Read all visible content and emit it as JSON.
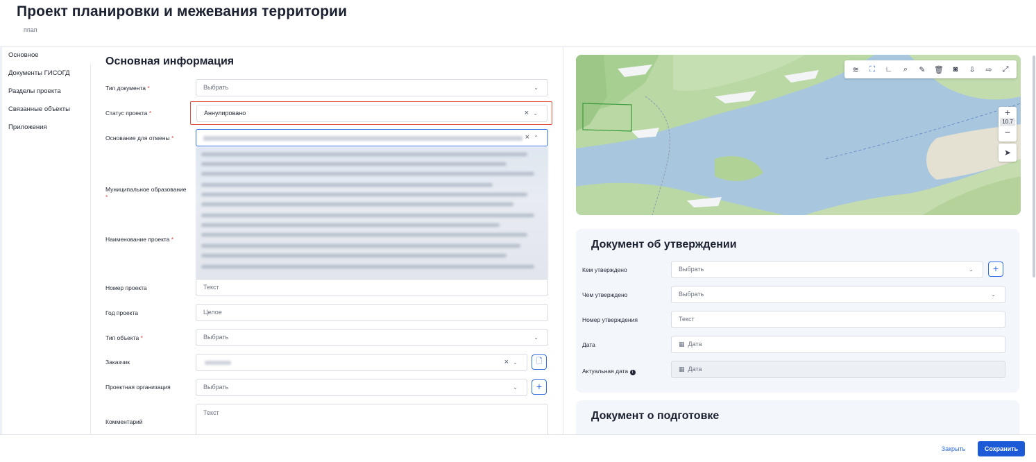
{
  "header": {
    "title": "Проект планировки и межевания территории",
    "subtitle": "ппап"
  },
  "sidebar": {
    "items": [
      {
        "label": "Основное"
      },
      {
        "label": "Документы ГИСОГД"
      },
      {
        "label": "Разделы проекта"
      },
      {
        "label": "Связанные объекты"
      },
      {
        "label": "Приложения"
      }
    ]
  },
  "main": {
    "section_title": "Основная информация",
    "fields": {
      "doc_type": {
        "label": "Тип документа",
        "placeholder": "Выбрать"
      },
      "status": {
        "label": "Статус проекта",
        "value": "Аннулировано"
      },
      "cancel_basis": {
        "label": "Основание для отмены"
      },
      "municipality": {
        "label": "Муниципальное образование"
      },
      "project_name": {
        "label": "Наименование проекта"
      },
      "project_number": {
        "label": "Номер проекта",
        "placeholder": "Текст"
      },
      "project_year": {
        "label": "Год проекта",
        "placeholder": "Целое"
      },
      "object_type": {
        "label": "Тип объекта",
        "placeholder": "Выбрать"
      },
      "customer": {
        "label": "Заказчик"
      },
      "design_org": {
        "label": "Проектная организация",
        "placeholder": "Выбрать"
      },
      "comment": {
        "label": "Комментарий",
        "placeholder": "Текст"
      }
    },
    "required_mark": "*"
  },
  "map": {
    "zoom_level": "10.7",
    "zoom_in": "+",
    "zoom_out": "−",
    "tools": [
      "layers-icon",
      "select-area-icon",
      "ruler-icon",
      "search-icon",
      "pencil-icon",
      "trash-icon",
      "camera-icon",
      "import-icon",
      "export-icon",
      "fullscreen-icon"
    ]
  },
  "approval": {
    "section_title": "Документ об утверждении",
    "approved_by": {
      "label": "Кем утверждено",
      "placeholder": "Выбрать"
    },
    "approved_with": {
      "label": "Чем утверждено",
      "placeholder": "Выбрать"
    },
    "approval_number": {
      "label": "Номер утверждения",
      "placeholder": "Текст"
    },
    "date": {
      "label": "Дата",
      "placeholder": "Дата"
    },
    "actual_date": {
      "label": "Актуальная дата",
      "placeholder": "Дата"
    }
  },
  "preparation": {
    "section_title": "Документ о подготовке"
  },
  "footer": {
    "close_label": "Закрыть",
    "save_label": "Сохранить"
  },
  "colors": {
    "accent": "#1d5ad8",
    "highlight": "#e05040",
    "required": "#e04646"
  }
}
